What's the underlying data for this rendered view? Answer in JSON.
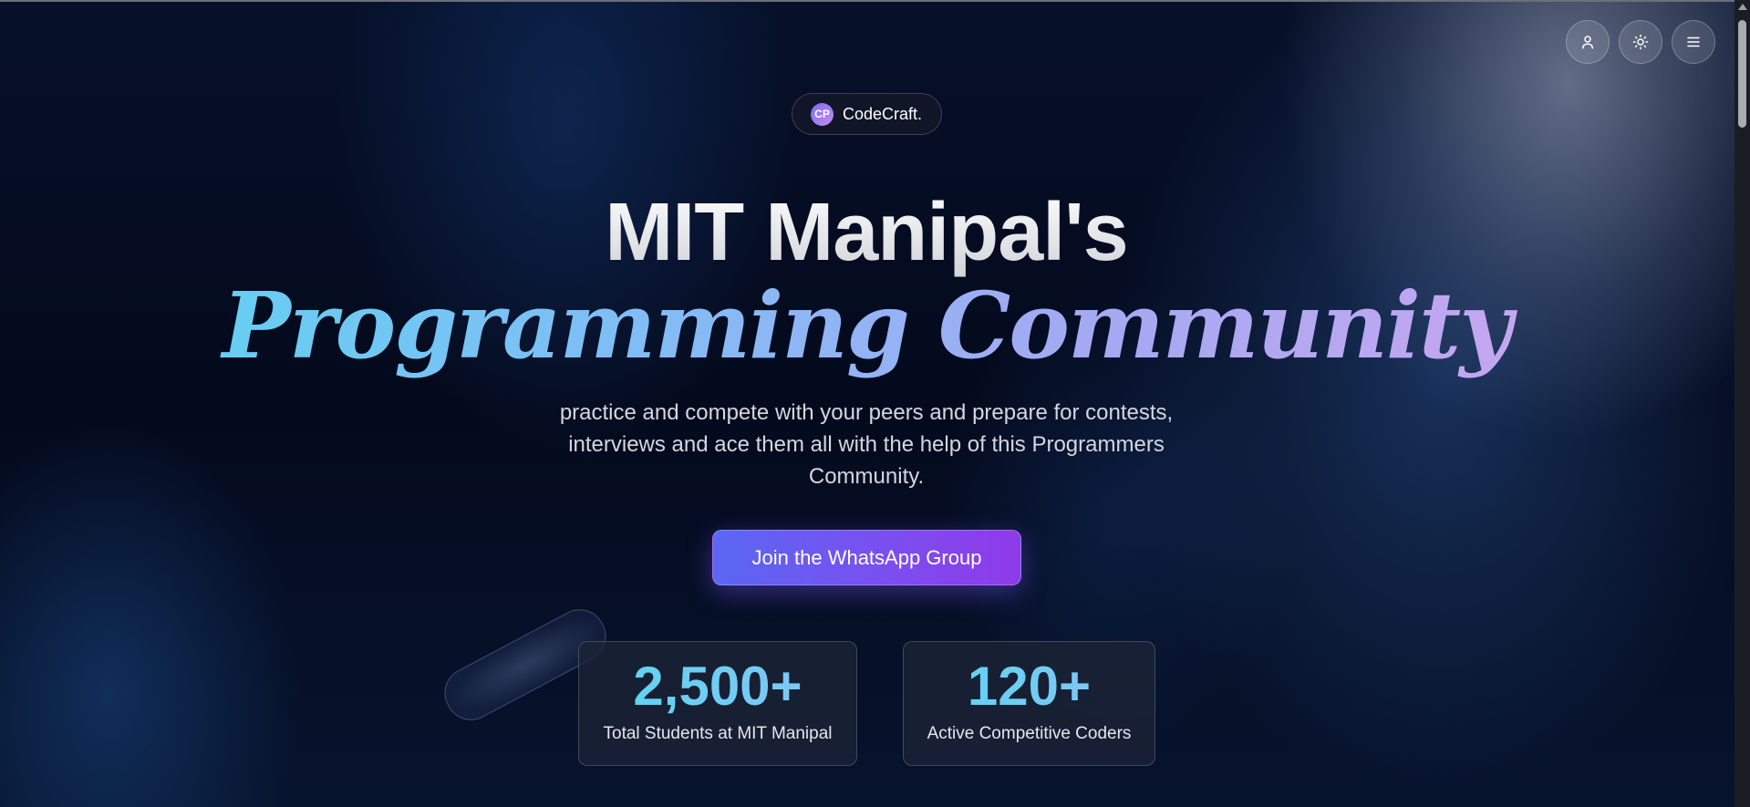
{
  "header": {
    "actions": [
      {
        "name": "user-icon"
      },
      {
        "name": "sun-icon"
      },
      {
        "name": "menu-icon"
      }
    ]
  },
  "brand": {
    "logo_text": "CP",
    "name": "CodeCraft."
  },
  "hero": {
    "title": "MIT Manipal's",
    "subtitle": "Programming Community",
    "description": "practice and compete with your peers and prepare for contests, interviews and ace them all with the help of this Programmers Community.",
    "cta_label": "Join the WhatsApp Group"
  },
  "stats": [
    {
      "value": "2,500+",
      "label": "Total Students at MIT Manipal"
    },
    {
      "value": "120+",
      "label": "Active Competitive Coders"
    }
  ],
  "colors": {
    "accent_start": "#5a67f2",
    "accent_end": "#8f3ae8",
    "cyan": "#5ad6f0",
    "lavender": "#d4a6ef"
  }
}
